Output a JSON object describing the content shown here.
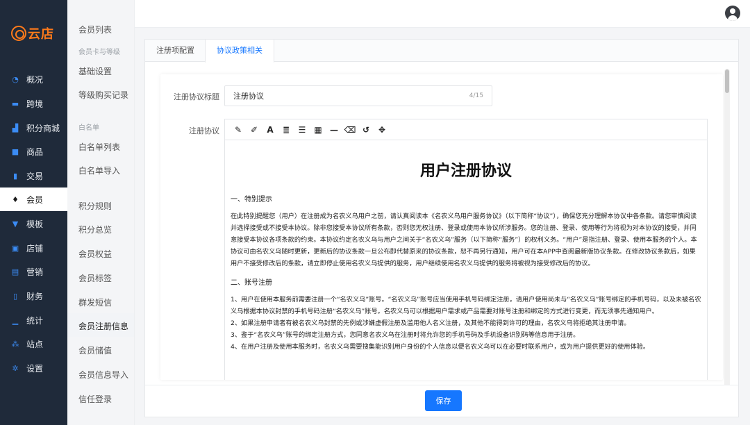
{
  "brand": {
    "logo_text": "云店",
    "logo_color": "#ff7a1a"
  },
  "nav": {
    "items": [
      {
        "label": "概况",
        "icon": "chart-icon"
      },
      {
        "label": "跨境",
        "icon": "box-icon"
      },
      {
        "label": "积分商城",
        "icon": "store-icon"
      },
      {
        "label": "商品",
        "icon": "bag-icon"
      },
      {
        "label": "交易",
        "icon": "document-icon"
      },
      {
        "label": "会员",
        "icon": "diamond-icon"
      },
      {
        "label": "模板",
        "icon": "template-icon"
      },
      {
        "label": "店铺",
        "icon": "shop-icon"
      },
      {
        "label": "营销",
        "icon": "gift-icon"
      },
      {
        "label": "财务",
        "icon": "finance-icon"
      },
      {
        "label": "统计",
        "icon": "stats-icon"
      },
      {
        "label": "站点",
        "icon": "sitemap-icon"
      },
      {
        "label": "设置",
        "icon": "gear-icon"
      }
    ],
    "active": "会员"
  },
  "subnav": {
    "member_list": "会员列表",
    "group_card": "会员卡与等级",
    "basic_settings": "基础设置",
    "level_purchase": "等级购买记录",
    "group_whitelist": "白名单",
    "whitelist_list": "白名单列表",
    "whitelist_import": "白名单导入",
    "points_rules": "积分规则",
    "points_overview": "积分总览",
    "member_rights": "会员权益",
    "member_tags": "会员标签",
    "group_sms": "群发短信",
    "member_register_info": "会员注册信息",
    "member_balance": "会员储值",
    "member_info_import": "会员信息导入",
    "trust_login": "信任登录"
  },
  "tabs": [
    {
      "label": "注册项配置"
    },
    {
      "label": "协议政策相关"
    }
  ],
  "active_tab": "协议政策相关",
  "form": {
    "title_label": "注册协议标题",
    "title_value": "注册协议",
    "title_counter": "4/15",
    "content_label": "注册协议"
  },
  "toolbar": [
    {
      "icon": "pencil-icon",
      "glyph": "✎"
    },
    {
      "icon": "brush-icon",
      "glyph": "✐"
    },
    {
      "icon": "font-icon",
      "glyph": "A"
    },
    {
      "icon": "align-icon",
      "glyph": "≣"
    },
    {
      "icon": "list-icon",
      "glyph": "☰"
    },
    {
      "icon": "table-icon",
      "glyph": "▦"
    },
    {
      "icon": "hr-icon",
      "glyph": "—"
    },
    {
      "icon": "eraser-icon",
      "glyph": "⌫"
    },
    {
      "icon": "undo-icon",
      "glyph": "↺"
    },
    {
      "icon": "move-icon",
      "glyph": "✥"
    }
  ],
  "doc": {
    "title": "用户注册协议",
    "sec1": "一、特别提示",
    "para1": "在此特别提醒您（用户）在注册成为名农义乌用户之前，请认真阅读本《名农义乌用户服务协议》（以下简称“协议”），确保您充分理解本协议中各条款。请您审慎阅读并选择接受或不接受本协议。除非您接受本协议所有条款，否则您无权注册、登录或使用本协议所涉服务。您的注册、登录、使用等行为将视为对本协议的接受，并同意接受本协议各项条款的约束。本协议约定名农义乌与用户之间关于“名农义乌”服务（以下简称“服务”）的权利义务。“用户”是指注册、登录、使用本服务的个人。本协议可由名农义乌随时更新，更新后的协议条款一旦公布即代替原来的协议条款，恕不再另行通知，用户可在本APP中查阅最新版协议条款。在修改协议条款后，如果用户不接受修改后的条款，请立即停止使用名农义乌提供的服务，用户继续使用名农义乌提供的服务将被视为接受修改后的协议。",
    "sec2": "二、账号注册",
    "item1": "1、用户在使用本服务前需要注册一个“名农义乌”账号。“名农义乌”账号应当使用手机号码绑定注册，请用户使用尚未与“名农义乌”账号绑定的手机号码，以及未被名农义乌根据本协议封禁的手机号码注册“名农义乌”账号。名农义乌可以根据用户需求或产品需要对账号注册和绑定的方式进行变更，而无须事先通知用户。",
    "item2": "2、如果注册申请者有被名农义乌封禁的先例或涉嫌虚假注册及滥用他人名义注册，及其他不能得到许可的理由，名农义乌将拒绝其注册申请。",
    "item3": "3、鉴于“名农义乌”账号的绑定注册方式，您同意名农义乌在注册时将允许您的手机号码及手机设备识别码等信息用于注册。",
    "item4": "4、在用户注册及使用本服务时，名农义乌需要搜集能识别用户身份的个人信息以便名农义乌可以在必要时联系用户，或为用户提供更好的使用体验。"
  },
  "footer": {
    "save_label": "保存"
  },
  "colors": {
    "primary": "#1677ff",
    "sidebar_bg": "#1f2a3a",
    "nav_icon": "#3b8cf5"
  }
}
